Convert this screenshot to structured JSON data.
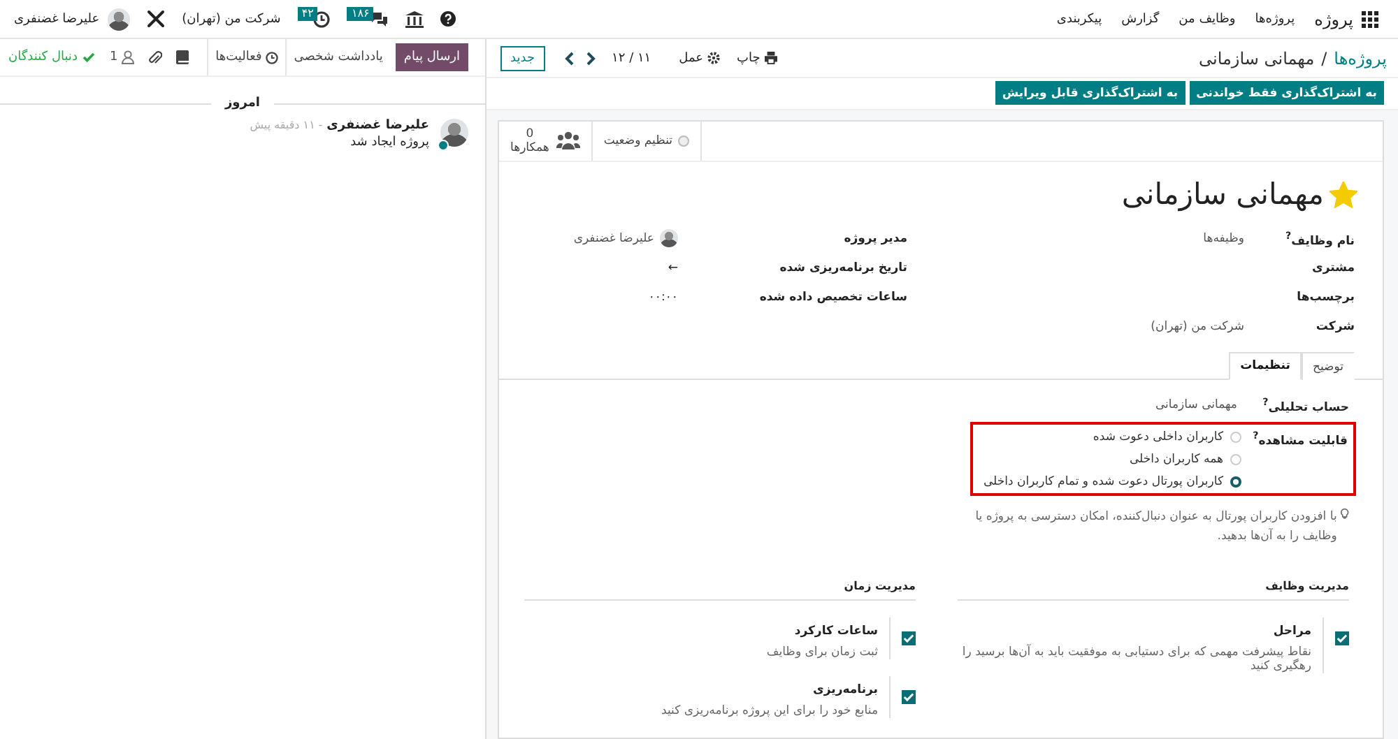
{
  "navbar": {
    "app_name": "پروژه",
    "menu": [
      "پروژه‌ها",
      "وظایف من",
      "گزارش",
      "پیکربندی"
    ],
    "message_badge": "۱۸۶",
    "activity_badge": "۴۲",
    "company": "شرکت من (تهران)",
    "user": "علیرضا غضنفری"
  },
  "control_panel": {
    "breadcrumb": "پروژه‌ها",
    "separator": "/",
    "current": "مهمانی سازمانی",
    "print": "چاپ",
    "action": "عمل",
    "pager": "۱۱ / ۱۲",
    "new_button": "جدید"
  },
  "header_buttons": [
    "به اشتراک‌گذاری فقط خواندنی",
    "به اشتراک‌گذاری قابل ویرایش"
  ],
  "smart_buttons": [
    {
      "kind": "status",
      "label": "تنظیم وضعیت"
    },
    {
      "kind": "count",
      "count": "0",
      "label": "همکارها"
    }
  ],
  "favorite": true,
  "title": "مهمانی سازمانی",
  "fields_right": [
    {
      "label": "نام وظایف$^{?}$",
      "value": "وظیفه‌ها"
    },
    {
      "label": "مشتری"
    },
    {
      "label": "برچسب‌ها"
    },
    {
      "label": "شرکت",
      "value": "شرکت من (تهران)"
    }
  ],
  "fields_left": [
    {
      "kind": "user",
      "label": "مدیر پروژه",
      "value": "علیرضا غضنفری"
    },
    {
      "kind": "text",
      "label": "تاریخ برنامه‌ریزی شده",
      "value": "←"
    },
    {
      "kind": "text",
      "label": "ساعات تخصیص داده شده",
      "value": "۰۰:۰۰"
    }
  ],
  "tabs": [
    {
      "label": "توضیح",
      "selected": false
    },
    {
      "label": "تنظیمات",
      "selected": true
    }
  ],
  "settings": {
    "analytic_label": "حساب تحلیلی$^{?}$",
    "analytic_value": "مهمانی سازمانی",
    "visibility_label": "قابلیت مشاهده$^{?}$",
    "visibility_options": [
      {
        "label": "کاربران داخلی دعوت شده",
        "selected": false
      },
      {
        "label": "همه کاربران داخلی",
        "selected": false
      },
      {
        "label": "کاربران پورتال دعوت شده و تمام کاربران داخلی",
        "selected": true
      }
    ],
    "hint": "با افزودن کاربران پورتال به عنوان دنبال‌کننده، امکان دسترسی به پروژه یا وظایف را به آن‌ها بدهید.",
    "sections": [
      {
        "title": "مدیریت وظایف",
        "options": [
          {
            "label": "مراحل",
            "description": "نقاط پیشرفت مهمی که برای دستیابی به موفقیت باید به آن‌ها برسید را رهگیری کنید",
            "checked": true
          }
        ]
      },
      {
        "title": "مدیریت زمان",
        "options": [
          {
            "label": "ساعات کارکرد",
            "description": "ثبت زمان برای وظایف",
            "checked": true
          },
          {
            "label": "برنامه‌ریزی",
            "description": "منابع خود را برای این پروژه برنامه‌ریزی کنید",
            "checked": true
          }
        ]
      }
    ]
  },
  "chatter": {
    "send_message": "ارسال پیام",
    "log_note": "یادداشت شخصی",
    "activities": "فعالیت‌ها",
    "follower_count": "1",
    "following": true,
    "follow_label": "دنبال کنندگان",
    "date_separator": "امروز",
    "messages": [
      {
        "author": "علیرضا غضنفری",
        "time": "- ۱۱ دقیقه پیش",
        "body": "پروژه ایجاد شد",
        "online": true
      }
    ]
  }
}
